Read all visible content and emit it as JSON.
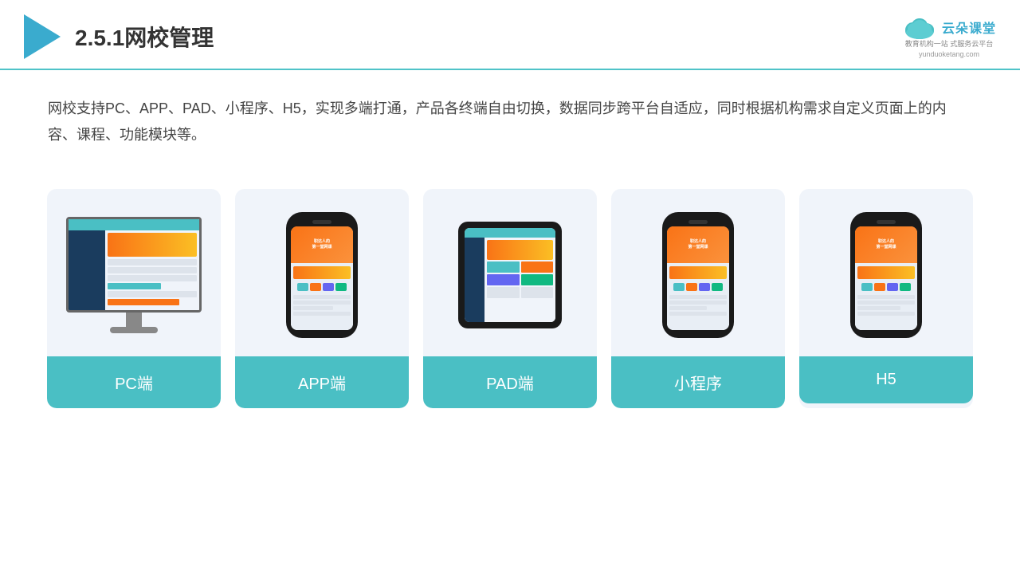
{
  "header": {
    "title": "2.5.1网校管理",
    "brand_name": "云朵课堂",
    "brand_url": "yunduoketang.com",
    "brand_tagline": "教育机构一站\n式服务云平台"
  },
  "description": {
    "text": "网校支持PC、APP、PAD、小程序、H5，实现多端打通，产品各终端自由切换，数据同步跨平台自适应，同时根据机构需求自定义页面上的内容、课程、功能模块等。"
  },
  "cards": [
    {
      "id": "pc",
      "label": "PC端"
    },
    {
      "id": "app",
      "label": "APP端"
    },
    {
      "id": "pad",
      "label": "PAD端"
    },
    {
      "id": "miniprogram",
      "label": "小程序"
    },
    {
      "id": "h5",
      "label": "H5"
    }
  ],
  "colors": {
    "accent": "#4ABFC4",
    "border_bottom": "#4ABFC4",
    "card_bg": "#F0F4FA",
    "card_label_bg": "#4ABFC4"
  }
}
